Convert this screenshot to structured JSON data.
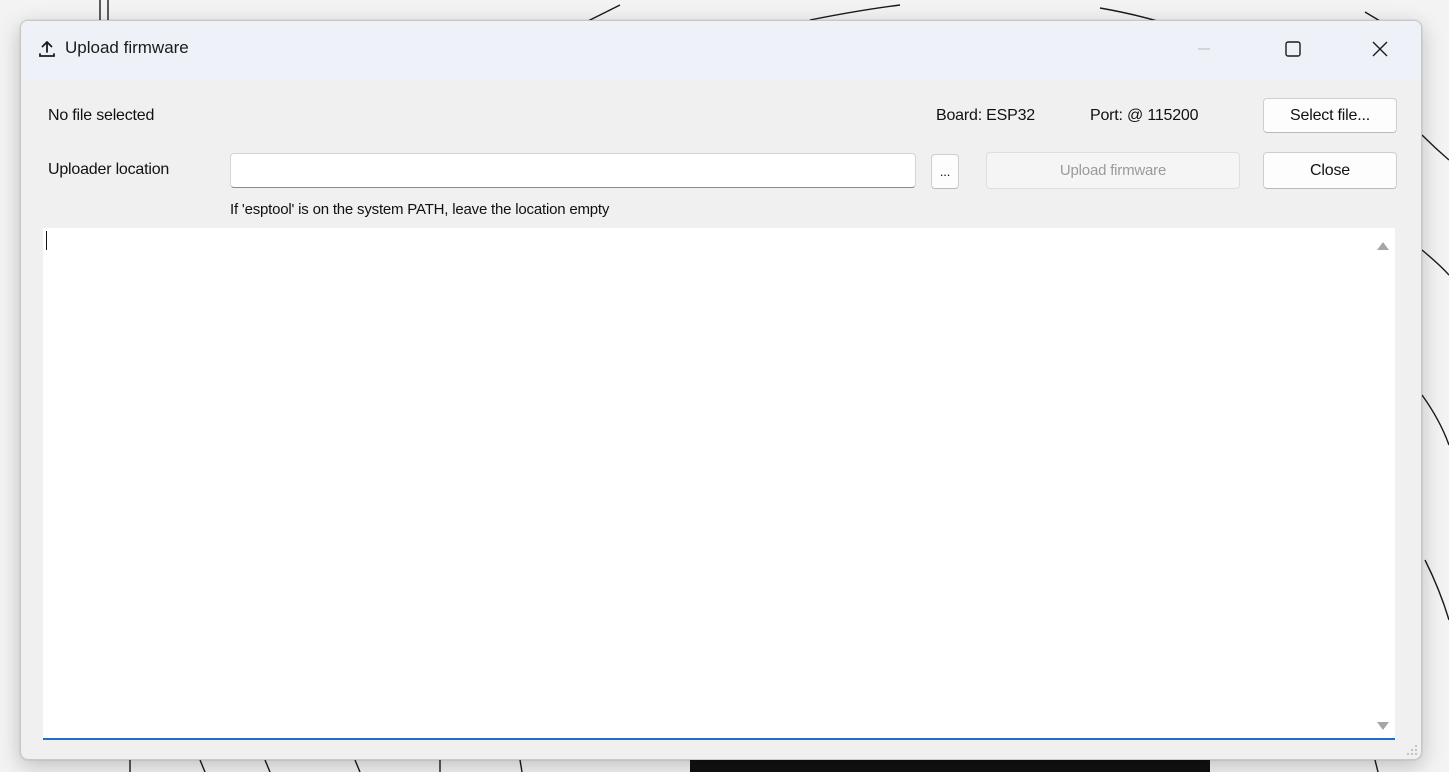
{
  "window": {
    "title": "Upload firmware",
    "icon": "upload-icon",
    "controls": {
      "minimize": "minimize-icon",
      "maximize": "maximize-icon",
      "close": "close-icon"
    }
  },
  "file_status": "No file selected",
  "board_info": "Board: ESP32",
  "port_info": "Port: @ 115200",
  "select_file_label": "Select file...",
  "uploader": {
    "label": "Uploader location",
    "value": "",
    "browse_label": "...",
    "hint": "If 'esptool' is on the system PATH, leave the location empty"
  },
  "upload_button_label": "Upload firmware",
  "close_button_label": "Close",
  "log": {
    "content": ""
  },
  "colors": {
    "accent": "#1e6fc8",
    "titlebar": "#eef2f8"
  }
}
